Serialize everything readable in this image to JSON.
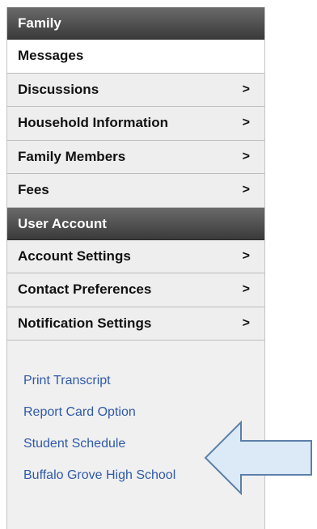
{
  "family": {
    "header": "Family",
    "items": [
      {
        "label": "Messages",
        "chevron": ""
      },
      {
        "label": "Discussions",
        "chevron": ">"
      },
      {
        "label": "Household Information",
        "chevron": ">"
      },
      {
        "label": "Family Members",
        "chevron": ">"
      },
      {
        "label": "Fees",
        "chevron": ">"
      }
    ]
  },
  "user_account": {
    "header": "User Account",
    "items": [
      {
        "label": "Account Settings",
        "chevron": ">"
      },
      {
        "label": "Contact Preferences",
        "chevron": ">"
      },
      {
        "label": "Notification Settings",
        "chevron": ">"
      }
    ]
  },
  "links": [
    {
      "label": "Print Transcript"
    },
    {
      "label": "Report Card Option"
    },
    {
      "label": "Student Schedule"
    },
    {
      "label": "Buffalo Grove High School"
    }
  ],
  "colors": {
    "link": "#2f5aa8",
    "header_bg": "#4a4a4a",
    "arrow_fill": "#dce9f7",
    "arrow_stroke": "#5b7fa8"
  },
  "annotation": {
    "icon": "left-arrow-icon"
  }
}
